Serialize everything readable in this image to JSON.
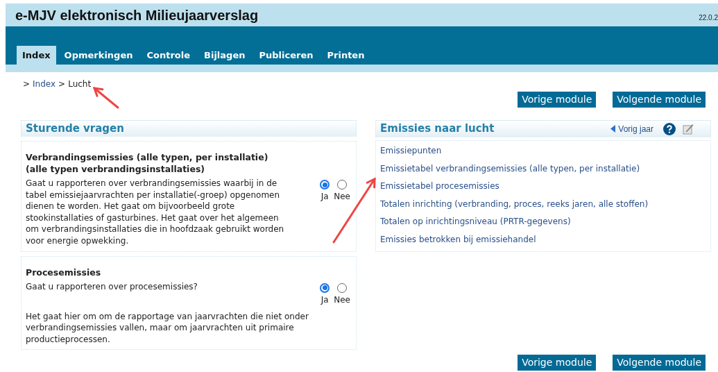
{
  "header": {
    "title": "e-MJV elektronisch Milieujaarverslag",
    "version": "22.0.2"
  },
  "tabs": [
    {
      "label": "Index",
      "selected": true
    },
    {
      "label": "Opmerkingen",
      "selected": false
    },
    {
      "label": "Controle",
      "selected": false
    },
    {
      "label": "Bijlagen",
      "selected": false
    },
    {
      "label": "Publiceren",
      "selected": false
    },
    {
      "label": "Printen",
      "selected": false
    }
  ],
  "breadcrumb": [
    {
      "sep": ">",
      "label": "Index"
    },
    {
      "sep": ">",
      "label": "Lucht"
    }
  ],
  "module_buttons_top": [
    "Vorige module",
    "Volgende module"
  ],
  "questions_panel": {
    "title": "Sturende vragen",
    "questions": [
      {
        "heading": "Verbrandingsemissies (alle typen, per installatie)\n(alle typen verbrandingsinstallaties)",
        "text": "Gaat u rapporteren over verbrandingsemissies waarbij in de tabel emissiejaarvrachten per installatie(-groep) opgenomen dienen te worden. Het gaat om bijvoorbeeld grote stookinstallaties of gasturbines. Het gaat over het algemeen om verbrandingsinstallaties die in hoofdzaak gebruikt worden voor energie opwekking.",
        "options": [
          {
            "label": "Ja",
            "selected": true
          },
          {
            "label": "Nee",
            "selected": false
          }
        ]
      },
      {
        "heading": "Procesemissies",
        "text": "Gaat u rapporteren over procesemissies?",
        "options": [
          {
            "label": "Ja",
            "selected": true
          },
          {
            "label": "Nee",
            "selected": false
          }
        ],
        "note": "Het gaat hier om om de rapportage van jaarvrachten die niet onder verbrandingsemissies vallen, maar om jaarvrachten uit primaire productieprocessen."
      }
    ]
  },
  "links_panel": {
    "title": "Emissies naar lucht",
    "previous_year": "Vorig jaar",
    "items": [
      "Emissiepunten",
      "Emissietabel verbrandingsemissies (alle typen, per installatie)",
      "Emissietabel procesemissies",
      "Totalen inrichting (verbranding, proces, reeks jaren, alle stoffen)",
      "Totalen op inrichtingsniveau (PRTR-gegevens)",
      "Emissies betrokken bij emissiehandel"
    ]
  },
  "module_buttons_bottom": [
    "Vorige module",
    "Volgende module"
  ]
}
